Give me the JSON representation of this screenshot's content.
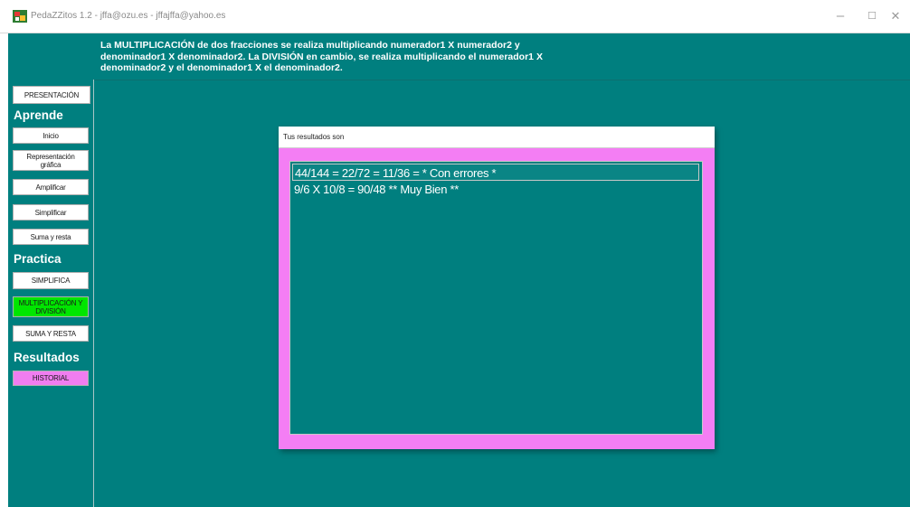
{
  "window": {
    "title": "PedaZZitos 1.2 - jffa@ozu.es - jffajffa@yahoo.es",
    "minimize": "–",
    "maximize": "☐",
    "close": "✕"
  },
  "info_text": "La MULTIPLICACIÓN de dos fracciones se realiza multiplicando numerador1 X numerador2 y denominador1 X denominador2. La DIVISIÓN en cambio, se realiza multiplicando el numerador1 X denominador2 y el denominador1 X el denominador2.",
  "sidebar": {
    "presentacion": "PRESENTACIÓN",
    "aprende_heading": "Aprende",
    "aprende": [
      "Inicio",
      "Representación gráfica",
      "Amplificar",
      "Simplificar",
      "Suma y resta"
    ],
    "practica_heading": "Practica",
    "practica": [
      "SIMPLIFICA",
      "MULTIPLICACIÓN Y DIVISIÓN",
      "SUMA Y RESTA"
    ],
    "resultados_heading": "Resultados",
    "historial": "HISTORIAL"
  },
  "dialog": {
    "title": "Tus resultados son",
    "results": [
      "44/144 = 22/72 = 11/36 =  * Con errores *",
      "9/6 X 10/8 = 90/48 ** Muy Bien **"
    ]
  },
  "colors": {
    "background": "#007f7f",
    "active_button": "#00e600",
    "dialog_border": "#f47ef4",
    "historial_button": "#f07df0"
  }
}
